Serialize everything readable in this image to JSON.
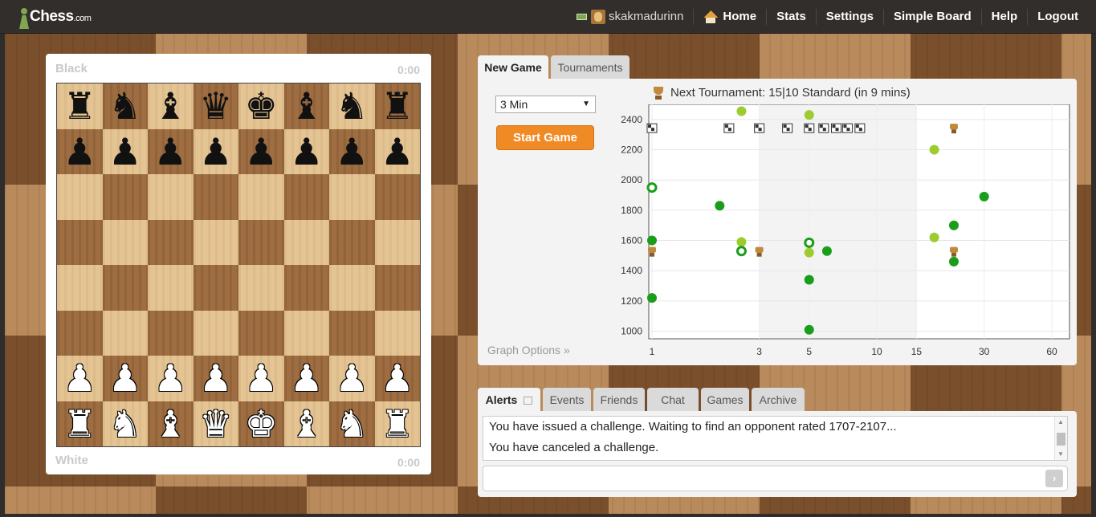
{
  "header": {
    "logo": "Chess",
    "logo_suffix": ".com",
    "username": "skakmadurinn",
    "nav": [
      "Home",
      "Stats",
      "Settings",
      "Simple Board",
      "Help",
      "Logout"
    ]
  },
  "board": {
    "top_player": "Black",
    "top_clock": "0:00",
    "bottom_player": "White",
    "bottom_clock": "0:00",
    "position": [
      [
        "♜",
        "♞",
        "♝",
        "♛",
        "♚",
        "♝",
        "♞",
        "♜"
      ],
      [
        "♟",
        "♟",
        "♟",
        "♟",
        "♟",
        "♟",
        "♟",
        "♟"
      ],
      [
        "",
        "",
        "",
        "",
        "",
        "",
        "",
        ""
      ],
      [
        "",
        "",
        "",
        "",
        "",
        "",
        "",
        ""
      ],
      [
        "",
        "",
        "",
        "",
        "",
        "",
        "",
        ""
      ],
      [
        "",
        "",
        "",
        "",
        "",
        "",
        "",
        ""
      ],
      [
        "♙",
        "♙",
        "♙",
        "♙",
        "♙",
        "♙",
        "♙",
        "♙"
      ],
      [
        "♖",
        "♘",
        "♗",
        "♕",
        "♔",
        "♗",
        "♘",
        "♖"
      ]
    ]
  },
  "game_tabs": [
    "New Game",
    "Tournaments"
  ],
  "new_game": {
    "time_control": "3 Min",
    "start_button": "Start Game",
    "graph_options": "Graph Options »",
    "next_tournament": "Next Tournament: 15|10 Standard (in 9 mins)"
  },
  "chart_data": {
    "type": "scatter",
    "x_ticks": [
      "1",
      "3",
      "5",
      "10",
      "15",
      "30",
      "60"
    ],
    "y_ticks": [
      "2400",
      "2200",
      "2000",
      "1800",
      "1600",
      "1400",
      "1200",
      "1000"
    ],
    "x_scale": "log",
    "xlim": [
      1,
      60
    ],
    "ylim": [
      950,
      2500
    ],
    "grid": true,
    "series": [
      {
        "values": [
          [
            1,
            1950
          ],
          [
            2,
            1830
          ],
          [
            1,
            1600
          ],
          [
            1,
            1220
          ],
          [
            5,
            1340
          ],
          [
            6,
            1530
          ],
          [
            5,
            1010
          ],
          [
            22,
            1700
          ],
          [
            22,
            1460
          ],
          [
            30,
            1890
          ]
        ],
        "color": "#1a9d1a"
      },
      {
        "values": [
          [
            2.5,
            2455
          ],
          [
            5,
            2430
          ],
          [
            2.5,
            1590
          ],
          [
            5,
            1520
          ],
          [
            18,
            2200
          ],
          [
            18,
            1620
          ]
        ],
        "color": "#9ccc2e"
      },
      {
        "values": [
          [
            1,
            1950
          ],
          [
            2.5,
            1530
          ],
          [
            5,
            1585
          ]
        ],
        "color": "#1a9d1a",
        "style": "ring"
      }
    ],
    "icons": [
      {
        "x": 1,
        "y": 2340,
        "icon": "flag-icon"
      },
      {
        "x": 2.2,
        "y": 2340,
        "icon": "flag-icon"
      },
      {
        "x": 3,
        "y": 2340,
        "icon": "flag-icon"
      },
      {
        "x": 4,
        "y": 2340,
        "icon": "flag-icon"
      },
      {
        "x": 5,
        "y": 2340,
        "icon": "flag-icon"
      },
      {
        "x": 5.8,
        "y": 2340,
        "icon": "flag-icon"
      },
      {
        "x": 6.6,
        "y": 2340,
        "icon": "flag-icon"
      },
      {
        "x": 7.4,
        "y": 2340,
        "icon": "flag-icon"
      },
      {
        "x": 8.4,
        "y": 2340,
        "icon": "flag-icon"
      },
      {
        "x": 22,
        "y": 2340,
        "icon": "trophy-icon"
      },
      {
        "x": 1,
        "y": 1525,
        "icon": "trophy-icon"
      },
      {
        "x": 3,
        "y": 1525,
        "icon": "trophy-icon"
      },
      {
        "x": 22,
        "y": 1525,
        "icon": "trophy-icon"
      }
    ]
  },
  "bottom_tabs": [
    "Alerts",
    "Events",
    "Friends",
    "Chat",
    "Games",
    "Archive"
  ],
  "alerts": [
    "You have issued a challenge. Waiting to find an opponent rated 1707-2107...",
    "You have canceled a challenge."
  ]
}
